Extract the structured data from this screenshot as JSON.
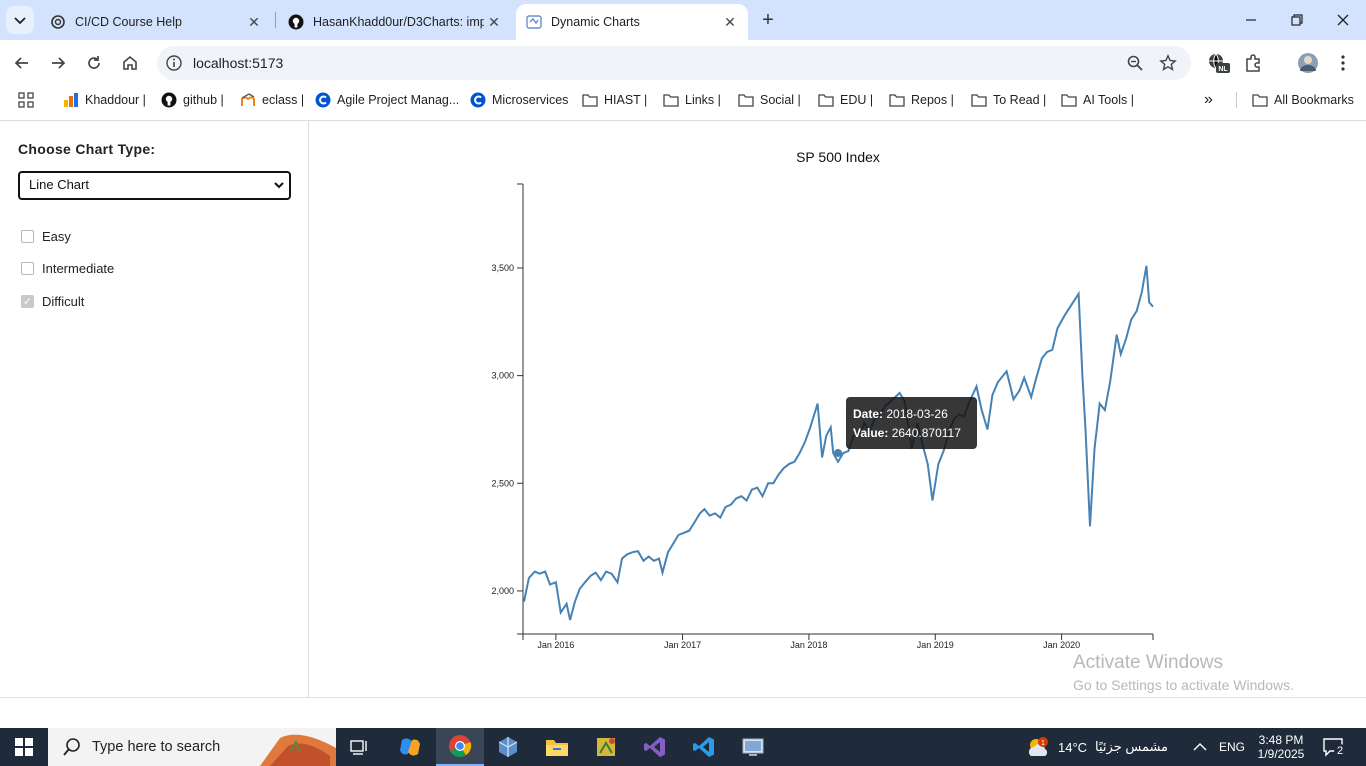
{
  "browser": {
    "tabs": [
      {
        "title": "CI/CD Course Help",
        "icon": "openai-icon",
        "active": false
      },
      {
        "title": "HasanKhadd0ur/D3Charts: imp",
        "icon": "github-icon",
        "active": false
      },
      {
        "title": "Dynamic Charts",
        "icon": "vite-icon",
        "active": true
      }
    ],
    "url": "localhost:5173",
    "bookmarks": [
      {
        "label": "Khaddour |",
        "icon": "analytics-icon"
      },
      {
        "label": "github |",
        "icon": "github-icon"
      },
      {
        "label": "eclass |",
        "icon": "moodle-icon"
      },
      {
        "label": "Agile Project Manag...",
        "icon": "coursera-icon"
      },
      {
        "label": "Microservices",
        "icon": "coursera-icon"
      },
      {
        "label": "HIAST |",
        "icon": "folder-icon"
      },
      {
        "label": "Links |",
        "icon": "folder-icon"
      },
      {
        "label": "Social |",
        "icon": "folder-icon"
      },
      {
        "label": "EDU |",
        "icon": "folder-icon"
      },
      {
        "label": "Repos |",
        "icon": "folder-icon"
      },
      {
        "label": "To Read |",
        "icon": "folder-icon"
      },
      {
        "label": "AI Tools |",
        "icon": "folder-icon"
      }
    ],
    "more_bookmarks": "»",
    "all_bookmarks": "All Bookmarks",
    "profile_badge": "NL"
  },
  "sidebar": {
    "heading": "Choose Chart Type:",
    "chart_type": "Line Chart",
    "filters": [
      {
        "label": "Easy",
        "checked": false
      },
      {
        "label": "Intermediate",
        "checked": false
      },
      {
        "label": "Difficult",
        "checked": true
      }
    ]
  },
  "tooltip": {
    "date_label": "Date:",
    "date_value": "2018-03-26",
    "value_label": "Value:",
    "value_value": "2640.870117"
  },
  "watermark": {
    "line1": "Activate Windows",
    "line2": "Go to Settings to activate Windows."
  },
  "taskbar": {
    "search_placeholder": "Type here to search",
    "weather": "14°C",
    "weather_text": "مشمس جزئيًا",
    "language": "ENG",
    "time": "3:48 PM",
    "date": "1/9/2025",
    "notification_count": "2"
  },
  "chart_data": {
    "type": "line",
    "title": "SP 500 Index",
    "xlabel": "",
    "ylabel": "",
    "xlim": [
      "2015-09-28",
      "2020-09-21"
    ],
    "ylim": [
      1800,
      3890
    ],
    "y_ticks": [
      2000,
      2500,
      3000,
      3500
    ],
    "y_tick_labels": [
      "2,000",
      "2,500",
      "3,000",
      "3,500"
    ],
    "x_ticks": [
      "2016-01-01",
      "2017-01-01",
      "2018-01-01",
      "2019-01-01",
      "2020-01-01"
    ],
    "x_tick_labels": [
      "Jan 2016",
      "Jan 2017",
      "Jan 2018",
      "Jan 2019",
      "Jan 2020"
    ],
    "color": "#4682b4",
    "highlight": {
      "x": "2018-03-26",
      "y": 2640.870117
    },
    "series": [
      {
        "x": [
          "2015-10-01",
          "2015-10-15",
          "2015-11-01",
          "2015-11-15",
          "2015-12-01",
          "2015-12-15",
          "2016-01-01",
          "2016-01-15",
          "2016-02-01",
          "2016-02-11",
          "2016-02-25",
          "2016-03-10",
          "2016-03-25",
          "2016-04-10",
          "2016-04-25",
          "2016-05-10",
          "2016-05-25",
          "2016-06-10",
          "2016-06-27",
          "2016-07-10",
          "2016-07-25",
          "2016-08-10",
          "2016-08-25",
          "2016-09-10",
          "2016-09-25",
          "2016-10-10",
          "2016-10-25",
          "2016-11-04",
          "2016-11-20",
          "2016-12-05",
          "2016-12-20",
          "2017-01-05",
          "2017-01-20",
          "2017-02-05",
          "2017-02-20",
          "2017-03-05",
          "2017-03-20",
          "2017-04-05",
          "2017-04-20",
          "2017-05-05",
          "2017-05-20",
          "2017-06-05",
          "2017-06-20",
          "2017-07-05",
          "2017-07-20",
          "2017-08-05",
          "2017-08-20",
          "2017-09-05",
          "2017-09-20",
          "2017-10-05",
          "2017-10-20",
          "2017-11-05",
          "2017-11-20",
          "2017-12-05",
          "2017-12-20",
          "2018-01-05",
          "2018-01-26",
          "2018-02-08",
          "2018-02-20",
          "2018-03-05",
          "2018-03-12",
          "2018-03-26",
          "2018-04-10",
          "2018-04-25",
          "2018-05-10",
          "2018-05-25",
          "2018-06-10",
          "2018-06-25",
          "2018-07-10",
          "2018-07-25",
          "2018-08-10",
          "2018-08-25",
          "2018-09-20",
          "2018-10-05",
          "2018-10-25",
          "2018-11-10",
          "2018-11-25",
          "2018-12-10",
          "2018-12-24",
          "2019-01-10",
          "2019-01-25",
          "2019-02-10",
          "2019-02-25",
          "2019-03-10",
          "2019-03-25",
          "2019-04-10",
          "2019-04-30",
          "2019-05-15",
          "2019-06-01",
          "2019-06-15",
          "2019-07-01",
          "2019-07-26",
          "2019-08-15",
          "2019-09-01",
          "2019-09-15",
          "2019-10-05",
          "2019-10-20",
          "2019-11-05",
          "2019-11-20",
          "2019-12-05",
          "2019-12-20",
          "2020-01-10",
          "2020-02-19",
          "2020-03-01",
          "2020-03-10",
          "2020-03-23",
          "2020-04-05",
          "2020-04-20",
          "2020-05-05",
          "2020-05-20",
          "2020-06-08",
          "2020-06-20",
          "2020-07-05",
          "2020-07-20",
          "2020-08-05",
          "2020-08-20",
          "2020-09-02",
          "2020-09-10",
          "2020-09-21"
        ],
        "y": [
          1950,
          2060,
          2090,
          2080,
          2090,
          2030,
          2040,
          1900,
          1940,
          1865,
          1950,
          2010,
          2040,
          2070,
          2085,
          2050,
          2090,
          2080,
          2040,
          2150,
          2170,
          2180,
          2185,
          2140,
          2160,
          2140,
          2150,
          2085,
          2180,
          2220,
          2260,
          2270,
          2280,
          2320,
          2360,
          2380,
          2350,
          2360,
          2340,
          2390,
          2400,
          2430,
          2440,
          2420,
          2470,
          2480,
          2440,
          2500,
          2500,
          2540,
          2570,
          2590,
          2600,
          2640,
          2690,
          2760,
          2870,
          2620,
          2720,
          2760,
          2640,
          2600,
          2640,
          2650,
          2720,
          2720,
          2780,
          2740,
          2800,
          2820,
          2860,
          2880,
          2920,
          2880,
          2660,
          2780,
          2680,
          2590,
          2420,
          2590,
          2650,
          2740,
          2800,
          2820,
          2810,
          2880,
          2950,
          2840,
          2750,
          2910,
          2970,
          3020,
          2890,
          2930,
          2990,
          2900,
          2990,
          3080,
          3110,
          3120,
          3220,
          3280,
          3380,
          3000,
          2750,
          2300,
          2660,
          2870,
          2840,
          2970,
          3190,
          3100,
          3170,
          3260,
          3300,
          3390,
          3510,
          3340,
          3320
        ]
      }
    ]
  }
}
